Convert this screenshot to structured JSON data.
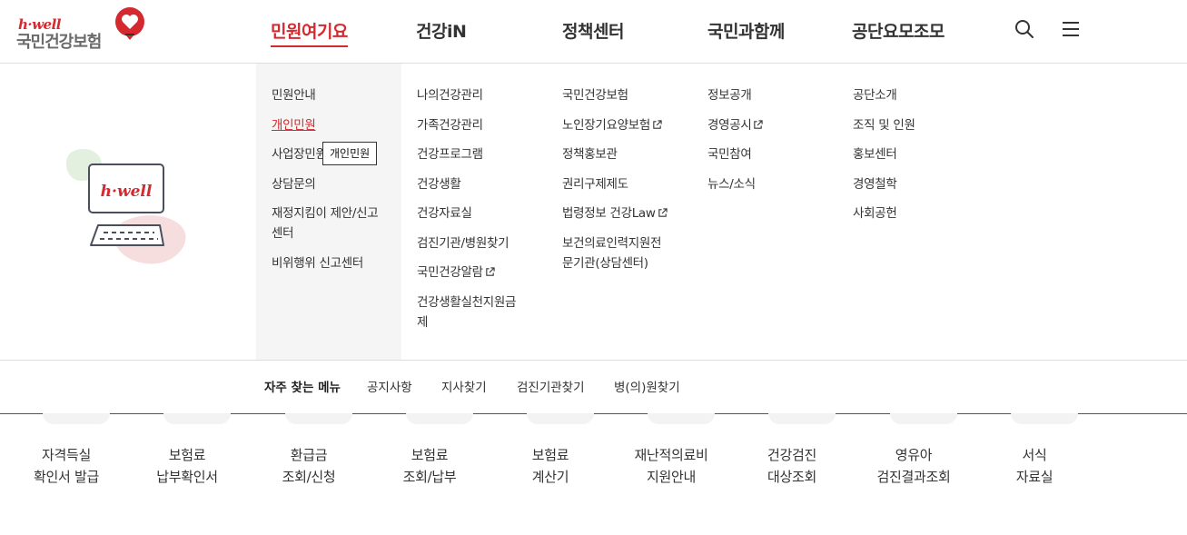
{
  "logo": {
    "sub": "h·well",
    "main": "국민건강보험"
  },
  "gnb": [
    {
      "label": "민원여기요",
      "active": true
    },
    {
      "label": "건강iN"
    },
    {
      "label": "정책센터"
    },
    {
      "label": "국민과함께"
    },
    {
      "label": "공단요모조모"
    }
  ],
  "illustration": {
    "screen_text": "h·well"
  },
  "menu": {
    "col1": [
      "민원안내",
      "개인민원",
      "사업장민원",
      "상담문의",
      "재정지킴이 제안/신고",
      "센터",
      "비위행위 신고센터"
    ],
    "col2": [
      "나의건강관리",
      "가족건강관리",
      "건강프로그램",
      "건강생활",
      "건강자료실",
      "검진기관/병원찾기",
      "국민건강알람",
      "건강생활실천지원금",
      "제"
    ],
    "col3": [
      "국민건강보험",
      "노인장기요양보험",
      "정책홍보관",
      "권리구제제도",
      "법령정보 건강Law",
      "보건의료인력지원전",
      "문기관(상담센터)"
    ],
    "col4": [
      "정보공개",
      "경영공시",
      "국민참여",
      "뉴스/소식"
    ],
    "col5": [
      "공단소개",
      "조직 및 인원",
      "홍보센터",
      "경영철학",
      "사회공헌"
    ]
  },
  "tooltip": "개인민원",
  "favorites": {
    "title": "자주 찾는 메뉴",
    "links": [
      "공지사항",
      "지사찾기",
      "검진기관찾기",
      "병(의)원찾기"
    ]
  },
  "quick": [
    {
      "line1": "자격득실",
      "line2": "확인서 발급"
    },
    {
      "line1": "보험료",
      "line2": "납부확인서"
    },
    {
      "line1": "환급금",
      "line2": "조회/신청"
    },
    {
      "line1": "보험료",
      "line2": "조회/납부"
    },
    {
      "line1": "보험료",
      "line2": "계산기"
    },
    {
      "line1": "재난적의료비",
      "line2": "지원안내"
    },
    {
      "line1": "건강검진",
      "line2": "대상조회"
    },
    {
      "line1": "영유아",
      "line2": "검진결과조회"
    },
    {
      "line1": "서식",
      "line2": "자료실"
    }
  ],
  "icons": {
    "search": "search-icon",
    "menu": "hamburger-menu-icon",
    "external": "external-link-icon"
  },
  "colors": {
    "accent": "#d4292e",
    "text": "#333333",
    "panel": "#f5f5f5"
  }
}
